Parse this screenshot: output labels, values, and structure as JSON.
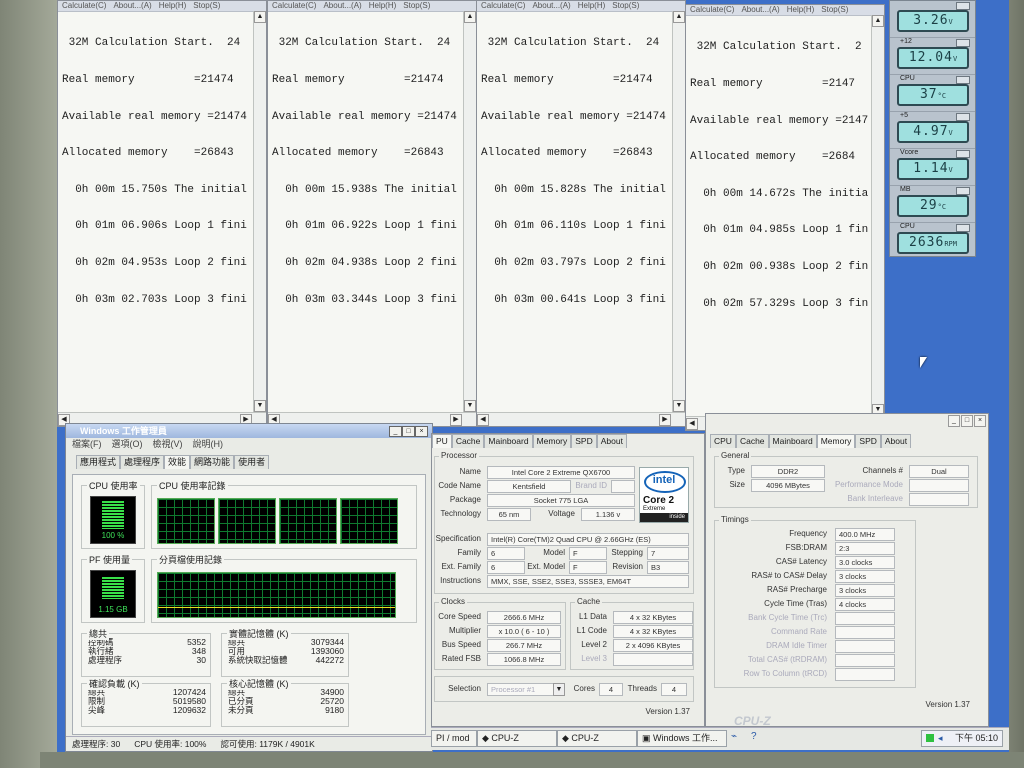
{
  "superpi": {
    "menu": [
      "Calculate(C)",
      "About...(A)",
      "Help(H)",
      "Stop(S)"
    ],
    "windows": [
      {
        "lines": [
          " 32M Calculation Start.  24",
          "Real memory         =21474",
          "Available real memory =21474",
          "Allocated memory    =26843",
          "  0h 00m 15.750s The initial",
          "  0h 01m 06.906s Loop 1 fini",
          "  0h 02m 04.953s Loop 2 fini",
          "  0h 03m 02.703s Loop 3 fini"
        ]
      },
      {
        "lines": [
          " 32M Calculation Start.  24",
          "Real memory         =21474",
          "Available real memory =21474",
          "Allocated memory    =26843",
          "  0h 00m 15.938s The initial",
          "  0h 01m 06.922s Loop 1 fini",
          "  0h 02m 04.938s Loop 2 fini",
          "  0h 03m 03.344s Loop 3 fini"
        ]
      },
      {
        "lines": [
          " 32M Calculation Start.  24",
          "Real memory         =21474",
          "Available real memory =21474",
          "Allocated memory    =26843",
          "  0h 00m 15.828s The initial",
          "  0h 01m 06.110s Loop 1 fini",
          "  0h 02m 03.797s Loop 2 fini",
          "  0h 03m 00.641s Loop 3 fini"
        ]
      },
      {
        "lines": [
          " 32M Calculation Start.  2",
          "Real memory         =2147",
          "Available real memory =2147",
          "Allocated memory    =2684",
          "  0h 00m 14.672s The initia",
          "  0h 01m 04.985s Loop 1 fin",
          "  0h 02m 00.938s Loop 2 fin",
          "  0h 02m 57.329s Loop 3 fin"
        ]
      }
    ]
  },
  "monitor": {
    "gauges": [
      {
        "label": "",
        "value": "3.26",
        "unit": "V"
      },
      {
        "label": "+12",
        "value": "12.04",
        "unit": "V"
      },
      {
        "label": "CPU",
        "value": "37",
        "unit": "°C"
      },
      {
        "label": "+5",
        "value": "4.97",
        "unit": "V"
      },
      {
        "label": "Vcore",
        "value": "1.14",
        "unit": "V"
      },
      {
        "label": "MB",
        "value": "29",
        "unit": "°C"
      },
      {
        "label": "CPU",
        "value": "2636",
        "unit": "RPM"
      }
    ]
  },
  "taskmgr": {
    "title": "Windows 工作管理員",
    "menu": [
      "檔案(F)",
      "選項(O)",
      "檢視(V)",
      "說明(H)"
    ],
    "tabs": [
      "應用程式",
      "處理程序",
      "效能",
      "網路功能",
      "使用者"
    ],
    "active_tab": 2,
    "cpu_usage_label": "CPU 使用率",
    "cpu_usage_value": "100 %",
    "cpu_history_label": "CPU 使用率記錄",
    "pf_label": "PF 使用量",
    "pf_value": "1.15 GB",
    "pf_history_label": "分頁檔使用記錄",
    "totals": {
      "title": "總共",
      "rows": [
        [
          "控制碼",
          "5352"
        ],
        [
          "執行緒",
          "348"
        ],
        [
          "處理程序",
          "30"
        ]
      ]
    },
    "physical": {
      "title": "實體記憶體 (K)",
      "rows": [
        [
          "總共",
          "3079344"
        ],
        [
          "可用",
          "1393060"
        ],
        [
          "系統快取記憶體",
          "442272"
        ]
      ]
    },
    "commit": {
      "title": "確認負載 (K)",
      "rows": [
        [
          "總共",
          "1207424"
        ],
        [
          "限制",
          "5019580"
        ],
        [
          "尖峰",
          "1209632"
        ]
      ]
    },
    "kernel": {
      "title": "核心記憶體 (K)",
      "rows": [
        [
          "總共",
          "34900"
        ],
        [
          "已分頁",
          "25720"
        ],
        [
          "未分頁",
          "9180"
        ]
      ]
    },
    "status": [
      "處理程序: 30",
      "CPU 使用率: 100%",
      "認可使用: 1179K / 4901K"
    ]
  },
  "cpuz_cpu": {
    "tabs": [
      "PU",
      "Cache",
      "Mainboard",
      "Memory",
      "SPD",
      "About"
    ],
    "processor_label": "Processor",
    "name_label": "Name",
    "name": "Intel Core 2 Extreme QX6700",
    "codename_label": "Code Name",
    "codename": "Kentsfield",
    "brandid_label": "Brand ID",
    "package_label": "Package",
    "package": "Socket 775 LGA",
    "tech_label": "Technology",
    "tech": "65 nm",
    "voltage_label": "Voltage",
    "voltage": "1.136 v",
    "spec_label": "Specification",
    "spec": "Intel(R) Core(TM)2 Quad CPU        @ 2.66GHz (ES)",
    "family_label": "Family",
    "family": "6",
    "model_label": "Model",
    "model": "F",
    "stepping_label": "Stepping",
    "stepping": "7",
    "extfamily_label": "Ext. Family",
    "extfamily": "6",
    "extmodel_label": "Ext. Model",
    "extmodel": "F",
    "revision_label": "Revision",
    "revision": "B3",
    "instr_label": "Instructions",
    "instr": "MMX, SSE, SSE2, SSE3, SSSE3, EM64T",
    "clocks_label": "Clocks",
    "corespeed_label": "Core Speed",
    "corespeed": "2666.6 MHz",
    "multiplier_label": "Multiplier",
    "multiplier": "x 10.0 ( 6 - 10 )",
    "busspeed_label": "Bus Speed",
    "busspeed": "266.7 MHz",
    "ratedfsb_label": "Rated FSB",
    "ratedfsb": "1066.8 MHz",
    "cache_label": "Cache",
    "l1data_label": "L1 Data",
    "l1data": "4 x 32 KBytes",
    "l1code_label": "L1 Code",
    "l1code": "4 x 32 KBytes",
    "level2_label": "Level 2",
    "level2": "2 x 4096 KBytes",
    "level3_label": "Level 3",
    "selection_label": "Selection",
    "selection": "Processor #1",
    "cores_label": "Cores",
    "cores": "4",
    "threads_label": "Threads",
    "threads": "4",
    "version": "Version 1.37",
    "logo_brand": "intel",
    "logo_line1": "Core 2",
    "logo_line2": "Extreme",
    "logo_inside": "inside"
  },
  "cpuz_mem": {
    "tabs": [
      "CPU",
      "Cache",
      "Mainboard",
      "Memory",
      "SPD",
      "About"
    ],
    "general_label": "General",
    "type_label": "Type",
    "type": "DDR2",
    "size_label": "Size",
    "size": "4096 MBytes",
    "channels_label": "Channels #",
    "channels": "Dual",
    "perfmode_label": "Performance Mode",
    "bankinter_label": "Bank Interleave",
    "timings_label": "Timings",
    "timings": [
      {
        "label": "Frequency",
        "value": "400.0 MHz"
      },
      {
        "label": "FSB:DRAM",
        "value": "2:3"
      },
      {
        "label": "CAS# Latency",
        "value": "3.0 clocks"
      },
      {
        "label": "RAS# to CAS# Delay",
        "value": "3 clocks"
      },
      {
        "label": "RAS# Precharge",
        "value": "3 clocks"
      },
      {
        "label": "Cycle Time (Tras)",
        "value": "4 clocks"
      },
      {
        "label": "Bank Cycle Time (Trc)",
        "value": ""
      },
      {
        "label": "Command Rate",
        "value": ""
      },
      {
        "label": "DRAM Idle Timer",
        "value": ""
      },
      {
        "label": "Total CAS# (tRDRAM)",
        "value": ""
      },
      {
        "label": "Row To Column (tRCD)",
        "value": ""
      }
    ],
    "version": "Version 1.37",
    "watermark": "CPU-Z"
  },
  "taskbar": {
    "buttons": [
      "PI / mod",
      "CPU-Z",
      "CPU-Z",
      "Windows 工作..."
    ],
    "clock": "下午 05:10"
  }
}
